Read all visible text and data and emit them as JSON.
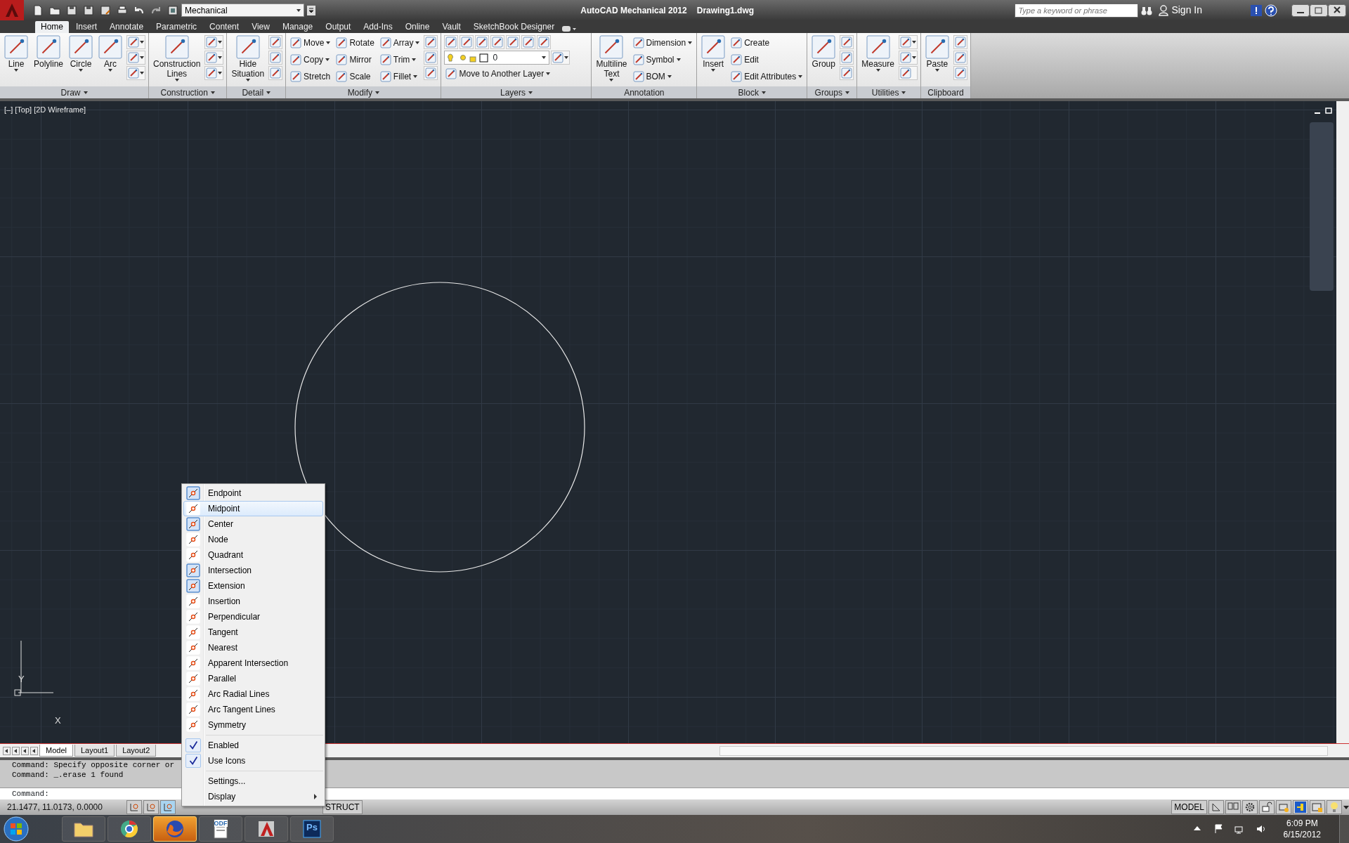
{
  "title_bar": {
    "workspace": "Mechanical",
    "app_title": "AutoCAD Mechanical 2012",
    "file_name": "Drawing1.dwg",
    "search": {
      "placeholder": "Type a keyword or phrase"
    },
    "sign_in": "Sign In"
  },
  "tabs": [
    {
      "label": "Home",
      "selected": true
    },
    {
      "label": "Insert",
      "selected": false
    },
    {
      "label": "Annotate",
      "selected": false
    },
    {
      "label": "Parametric",
      "selected": false
    },
    {
      "label": "Content",
      "selected": false
    },
    {
      "label": "View",
      "selected": false
    },
    {
      "label": "Manage",
      "selected": false
    },
    {
      "label": "Output",
      "selected": false
    },
    {
      "label": "Add-Ins",
      "selected": false
    },
    {
      "label": "Online",
      "selected": false
    },
    {
      "label": "Vault",
      "selected": false
    },
    {
      "label": "SketchBook Designer",
      "selected": false
    }
  ],
  "panels": [
    {
      "title": "Draw",
      "menu": true,
      "kind": "columns",
      "items": [
        {
          "kind": "large",
          "label": "Line",
          "dropdown": true
        },
        {
          "kind": "large",
          "label": "Polyline",
          "dropdown": false
        },
        {
          "kind": "large",
          "label": "Circle",
          "dropdown": true
        },
        {
          "kind": "large",
          "label": "Arc",
          "dropdown": true
        },
        {
          "kind": "icon",
          "dropdown": true
        },
        {
          "kind": "icon",
          "dropdown": true
        },
        {
          "kind": "icon",
          "dropdown": true
        }
      ]
    },
    {
      "title": "Construction",
      "menu": true,
      "kind": "columns",
      "items": [
        {
          "kind": "large",
          "label": "Construction Lines",
          "dropdown": true
        },
        {
          "kind": "icon",
          "dropdown": true
        },
        {
          "kind": "icon",
          "dropdown": true
        },
        {
          "kind": "icon",
          "dropdown": true
        }
      ]
    },
    {
      "title": "Detail",
      "menu": true,
      "kind": "columns",
      "items": [
        {
          "kind": "large",
          "label": "Hide Situation",
          "dropdown": true
        },
        {
          "kind": "icon",
          "dropdown": false
        },
        {
          "kind": "icon",
          "dropdown": false
        },
        {
          "kind": "icon",
          "dropdown": false
        }
      ]
    },
    {
      "title": "Modify",
      "menu": true,
      "kind": "columns",
      "items": [
        {
          "kind": "small",
          "label": "Move",
          "dropdown": true
        },
        {
          "kind": "small",
          "label": "Copy",
          "dropdown": true
        },
        {
          "kind": "small",
          "label": "Stretch",
          "dropdown": false
        },
        {
          "kind": "small",
          "label": "Rotate",
          "dropdown": false
        },
        {
          "kind": "small",
          "label": "Mirror",
          "dropdown": false
        },
        {
          "kind": "small",
          "label": "Scale",
          "dropdown": false
        },
        {
          "kind": "small",
          "label": "Array",
          "dropdown": true
        },
        {
          "kind": "small",
          "label": "Trim",
          "dropdown": true
        },
        {
          "kind": "small",
          "label": "Fillet",
          "dropdown": true
        },
        {
          "kind": "icon",
          "dropdown": false
        },
        {
          "kind": "icon",
          "dropdown": false
        },
        {
          "kind": "icon",
          "dropdown": false
        }
      ]
    },
    {
      "title": "Layers",
      "menu": true,
      "kind": "rows",
      "items": [
        {
          "kind": "icon",
          "dropdown": false
        },
        {
          "kind": "icon",
          "dropdown": false
        },
        {
          "kind": "icon",
          "dropdown": false
        },
        {
          "kind": "icon",
          "dropdown": false
        },
        {
          "kind": "icon",
          "dropdown": false
        },
        {
          "kind": "icon",
          "dropdown": false
        },
        {
          "kind": "icon",
          "dropdown": false
        },
        {
          "kind": "select",
          "label": "0",
          "dropdown": true
        },
        {
          "kind": "icon",
          "dropdown": true
        },
        {
          "kind": "small",
          "label": "Move to Another Layer",
          "dropdown": true
        }
      ]
    },
    {
      "title": "Annotation",
      "menu": false,
      "kind": "columns",
      "items": [
        {
          "kind": "large",
          "label": "Multiline Text",
          "dropdown": true
        },
        {
          "kind": "small",
          "label": "Dimension",
          "dropdown": true
        },
        {
          "kind": "small",
          "label": "Symbol",
          "dropdown": true
        },
        {
          "kind": "small",
          "label": "BOM",
          "dropdown": true
        }
      ]
    },
    {
      "title": "Block",
      "menu": true,
      "kind": "columns",
      "items": [
        {
          "kind": "large",
          "label": "Insert",
          "dropdown": true
        },
        {
          "kind": "small",
          "label": "Create",
          "dropdown": false
        },
        {
          "kind": "small",
          "label": "Edit",
          "dropdown": false
        },
        {
          "kind": "small",
          "label": "Edit Attributes",
          "dropdown": true
        }
      ]
    },
    {
      "title": "Groups",
      "menu": true,
      "kind": "columns",
      "items": [
        {
          "kind": "large",
          "label": "Group",
          "dropdown": false
        },
        {
          "kind": "icon",
          "dropdown": false
        },
        {
          "kind": "icon",
          "dropdown": false
        },
        {
          "kind": "icon",
          "dropdown": false
        }
      ]
    },
    {
      "title": "Utilities",
      "menu": true,
      "kind": "columns",
      "items": [
        {
          "kind": "large",
          "label": "Measure",
          "dropdown": true
        },
        {
          "kind": "icon",
          "dropdown": true
        },
        {
          "kind": "icon",
          "dropdown": true
        },
        {
          "kind": "icon",
          "dropdown": false
        }
      ]
    },
    {
      "title": "Clipboard",
      "menu": false,
      "kind": "columns",
      "items": [
        {
          "kind": "large",
          "label": "Paste",
          "dropdown": true
        },
        {
          "kind": "icon",
          "dropdown": false
        },
        {
          "kind": "icon",
          "dropdown": false
        },
        {
          "kind": "icon",
          "dropdown": false
        }
      ]
    }
  ],
  "viewport": {
    "label": "[–] [Top] [2D Wireframe]",
    "ucs": {
      "y": "Y",
      "x": "X"
    }
  },
  "layout_tabs": [
    {
      "label": "Model",
      "selected": true
    },
    {
      "label": "Layout1",
      "selected": false
    },
    {
      "label": "Layout2",
      "selected": false
    }
  ],
  "command": {
    "history": [
      "Command: Specify opposite corner or",
      "Command: _.erase 1 found"
    ],
    "prompt": "Command:"
  },
  "status_bar": {
    "coordinates": "21.1477, 11.0173, 0.0000",
    "toggles": [
      {
        "on": false
      },
      {
        "on": false
      },
      {
        "on": true
      }
    ],
    "struct": "STRUCT",
    "space": "MODEL"
  },
  "context_menu": {
    "items": [
      {
        "kind": "snap",
        "label": "Endpoint",
        "checked": true,
        "selected": false
      },
      {
        "kind": "snap",
        "label": "Midpoint",
        "checked": false,
        "selected": true
      },
      {
        "kind": "snap",
        "label": "Center",
        "checked": true,
        "selected": false
      },
      {
        "kind": "snap",
        "label": "Node",
        "checked": false,
        "selected": false
      },
      {
        "kind": "snap",
        "label": "Quadrant",
        "checked": false,
        "selected": false
      },
      {
        "kind": "snap",
        "label": "Intersection",
        "checked": true,
        "selected": false
      },
      {
        "kind": "snap",
        "label": "Extension",
        "checked": true,
        "selected": false
      },
      {
        "kind": "snap",
        "label": "Insertion",
        "checked": false,
        "selected": false
      },
      {
        "kind": "snap",
        "label": "Perpendicular",
        "checked": false,
        "selected": false
      },
      {
        "kind": "snap",
        "label": "Tangent",
        "checked": false,
        "selected": false
      },
      {
        "kind": "snap",
        "label": "Nearest",
        "checked": false,
        "selected": false
      },
      {
        "kind": "snap",
        "label": "Apparent Intersection",
        "checked": false,
        "selected": false
      },
      {
        "kind": "snap",
        "label": "Parallel",
        "checked": false,
        "selected": false
      },
      {
        "kind": "snap",
        "label": "Arc Radial Lines",
        "checked": false,
        "selected": false
      },
      {
        "kind": "snap",
        "label": "Arc Tangent Lines",
        "checked": false,
        "selected": false
      },
      {
        "kind": "snap",
        "label": "Symmetry",
        "checked": false,
        "selected": false
      },
      {
        "kind": "toggle",
        "label": "Enabled",
        "checked": true,
        "selected": false
      },
      {
        "kind": "toggle",
        "label": "Use Icons",
        "checked": true,
        "selected": false
      },
      {
        "kind": "command",
        "label": "Settings...",
        "selected": false
      },
      {
        "kind": "submenu",
        "label": "Display",
        "selected": false
      }
    ]
  },
  "taskbar": {
    "apps": [
      {
        "selected": false
      },
      {
        "selected": false
      },
      {
        "selected": true
      },
      {
        "selected": false,
        "badge": "ODF"
      },
      {
        "selected": false
      },
      {
        "selected": false,
        "badge": "Ps"
      }
    ],
    "time": "6:09 PM",
    "date": "6/15/2012"
  }
}
